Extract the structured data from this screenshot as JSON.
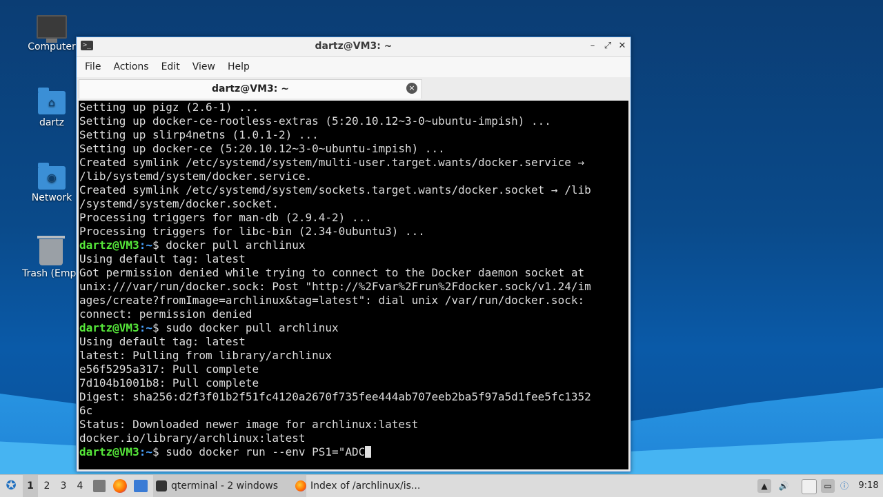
{
  "desktop": {
    "icons": [
      {
        "label": "Computer"
      },
      {
        "label": "dartz"
      },
      {
        "label": "Network"
      },
      {
        "label": "Trash (Empt"
      }
    ]
  },
  "window": {
    "title": "dartz@VM3: ~",
    "app_icon": ">_",
    "controls": {
      "minimize": "–",
      "maximize": "⤢",
      "close": "✕"
    },
    "menu": [
      "File",
      "Actions",
      "Edit",
      "View",
      "Help"
    ],
    "tab": {
      "label": "dartz@VM3: ~",
      "close": "×"
    }
  },
  "terminal": {
    "prompt_user": "dartz@VM3",
    "prompt_path": ":~",
    "prompt_symbol": "$ ",
    "lines": [
      {
        "text": "Setting up pigz (2.6-1) ..."
      },
      {
        "text": "Setting up docker-ce-rootless-extras (5:20.10.12~3-0~ubuntu-impish) ..."
      },
      {
        "text": "Setting up slirp4netns (1.0.1-2) ..."
      },
      {
        "text": "Setting up docker-ce (5:20.10.12~3-0~ubuntu-impish) ..."
      },
      {
        "text": "Created symlink /etc/systemd/system/multi-user.target.wants/docker.service →"
      },
      {
        "text": "/lib/systemd/system/docker.service."
      },
      {
        "text": "Created symlink /etc/systemd/system/sockets.target.wants/docker.socket → /lib"
      },
      {
        "text": "/systemd/system/docker.socket."
      },
      {
        "text": "Processing triggers for man-db (2.9.4-2) ..."
      },
      {
        "text": "Processing triggers for libc-bin (2.34-0ubuntu3) ..."
      },
      {
        "prompt": true,
        "text": "docker pull archlinux"
      },
      {
        "text": "Using default tag: latest"
      },
      {
        "text": "Got permission denied while trying to connect to the Docker daemon socket at"
      },
      {
        "text": "unix:///var/run/docker.sock: Post \"http://%2Fvar%2Frun%2Fdocker.sock/v1.24/im"
      },
      {
        "text": "ages/create?fromImage=archlinux&tag=latest\": dial unix /var/run/docker.sock:"
      },
      {
        "text": "connect: permission denied"
      },
      {
        "prompt": true,
        "text": "sudo docker pull archlinux"
      },
      {
        "text": "Using default tag: latest"
      },
      {
        "text": "latest: Pulling from library/archlinux"
      },
      {
        "text": "e56f5295a317: Pull complete"
      },
      {
        "text": "7d104b1001b8: Pull complete"
      },
      {
        "text": "Digest: sha256:d2f3f01b2f51fc4120a2670f735fee444ab707eeb2ba5f97a5d1fee5fc1352"
      },
      {
        "text": "6c"
      },
      {
        "text": "Status: Downloaded newer image for archlinux:latest"
      },
      {
        "text": "docker.io/library/archlinux:latest"
      },
      {
        "prompt": true,
        "text": "sudo docker run --env PS1=\"ADC",
        "cursor": true
      }
    ]
  },
  "taskbar": {
    "workspaces": [
      "1",
      "2",
      "3",
      "4"
    ],
    "active_workspace": "1",
    "tasks": [
      {
        "label": "qterminal - 2 windows",
        "icon": "terminal-icon"
      },
      {
        "label": "Index of /archlinux/is...",
        "icon": "firefox-icon"
      }
    ],
    "clock": "9:18"
  }
}
